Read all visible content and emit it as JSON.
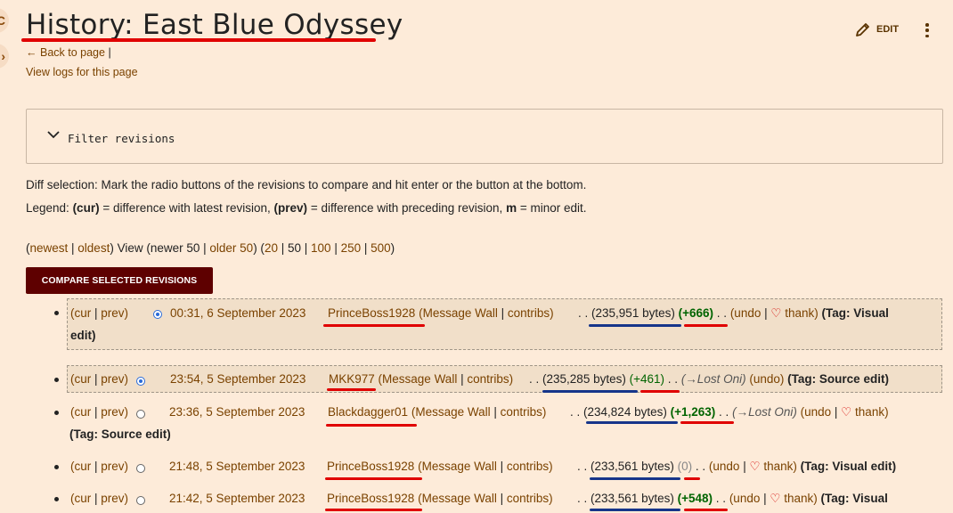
{
  "page": {
    "title": "History: East Blue Odyssey",
    "edit_label": "EDIT",
    "back_label": "Back to page",
    "back_sep": "|",
    "logs_label": "View logs for this page"
  },
  "filter": {
    "label": "Filter revisions"
  },
  "help": {
    "diff_selection": "Diff selection: Mark the radio buttons of the revisions to compare and hit enter or the button at the bottom.",
    "legend_prefix": "Legend: ",
    "legend_cur": "(cur)",
    "legend_cur_text": " = difference with latest revision, ",
    "legend_prev": "(prev)",
    "legend_prev_text": " = difference with preceding revision, ",
    "legend_m": "m",
    "legend_m_text": " = minor edit."
  },
  "nav": {
    "open": "(",
    "newest": "newest",
    "sep": " | ",
    "oldest": "oldest",
    "view_text": ") View (newer 50 | ",
    "older": "older 50",
    "mid": ") (",
    "n20": "20",
    "n50": "50",
    "n100": "100",
    "n250": "250",
    "n500": "500",
    "close": ")"
  },
  "compare_button": "COMPARE SELECTED REVISIONS",
  "revisions": [
    {
      "cur": "(cur",
      "prev": "prev)",
      "date": "00:31, 6 September 2023",
      "user": "PrinceBoss1928",
      "wall": "(Message Wall",
      "contribs": "contribs)",
      "dots": ". .",
      "size": "(235,951 bytes)",
      "delta": "(+666)",
      "tail_dots": ". .",
      "undo": "(undo",
      "thank": "thank)",
      "tag_open": "(Tag:",
      "tag": "Visual",
      "tag_line2": "edit)"
    },
    {
      "cur": "(cur",
      "prev": "prev)",
      "date": "23:54, 5 September 2023",
      "user": "MKK977",
      "wall": "(Message Wall",
      "contribs": "contribs)",
      "dots": ". .",
      "size": "(235,285 bytes)",
      "delta": "(+461)",
      "tail_dots": ". .",
      "comment": "(→Lost Oni)",
      "undo": "(undo)",
      "tag_open": "(Tag:",
      "tag": "Source edit)"
    },
    {
      "cur": "(cur",
      "prev": "prev)",
      "date": "23:36, 5 September 2023",
      "user": "Blackdagger01",
      "wall": "(Message Wall",
      "contribs": "contribs)",
      "dots": ". .",
      "size": "(234,824 bytes)",
      "delta": "(+1,263)",
      "tail_dots": ". .",
      "comment": "(→Lost Oni)",
      "undo": "(undo",
      "thank": "thank)",
      "tag_open": "(Tag:",
      "tag": "Source edit)"
    },
    {
      "cur": "(cur",
      "prev": "prev)",
      "date": "21:48, 5 September 2023",
      "user": "PrinceBoss1928",
      "wall": "(Message Wall",
      "contribs": "contribs)",
      "dots": ". .",
      "size": "(233,561 bytes)",
      "delta": "(0)",
      "tail_dots": ". .",
      "undo": "(undo",
      "thank": "thank)",
      "tag_open": "(Tag:",
      "tag": "Visual edit)"
    },
    {
      "cur": "(cur",
      "prev": "prev)",
      "date": "21:42, 5 September 2023",
      "user": "PrinceBoss1928",
      "wall": "(Message Wall",
      "contribs": "contribs)",
      "dots": ". .",
      "size": "(233,561 bytes)",
      "delta": "(+548)",
      "tail_dots": ". .",
      "undo": "(undo",
      "thank": "thank)",
      "tag_open": "(Tag:",
      "tag": "Visual"
    }
  ],
  "colors": {
    "background": "#fdebd9",
    "link": "#7a4200",
    "button": "#5e0000",
    "positive": "#006400",
    "annotation_red": "#e00000",
    "annotation_blue": "#16358a"
  }
}
